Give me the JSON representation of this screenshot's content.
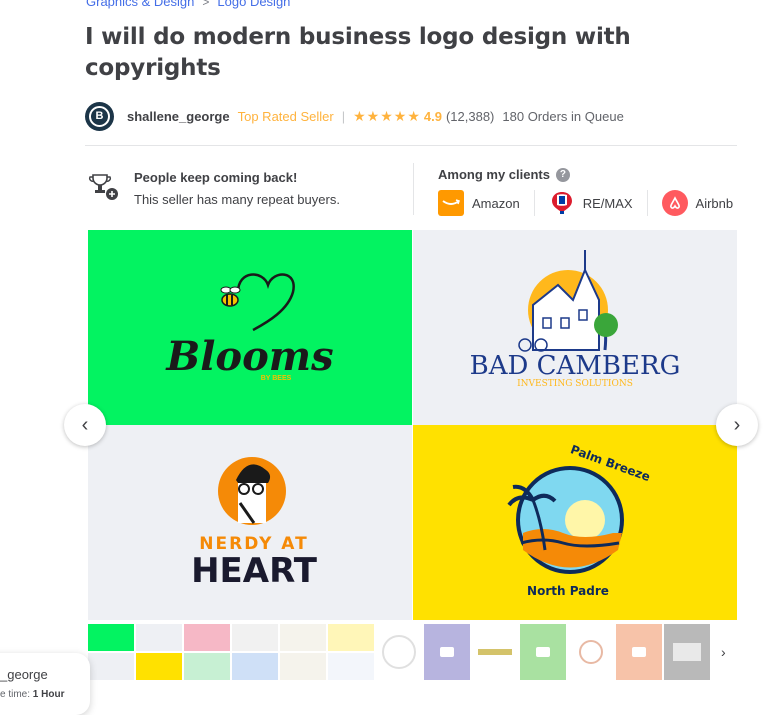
{
  "breadcrumb": {
    "items": [
      "Graphics & Design",
      "Logo Design"
    ],
    "separator": ">"
  },
  "gig": {
    "title": "I will do modern business logo design with copyrights"
  },
  "seller": {
    "avatar_letter": "B",
    "username": "shallene_george",
    "level": "Top Rated Seller",
    "separator": "|",
    "stars": "★★★★★",
    "rating": "4.9",
    "review_count": "(12,388)",
    "orders_in_queue": "180 Orders in Queue"
  },
  "highlights": {
    "title": "People keep coming back!",
    "text": "This seller has many repeat buyers."
  },
  "clients": {
    "title": "Among my clients",
    "help_icon": "?",
    "list": [
      {
        "name": "Amazon",
        "icon": "amazon-logo",
        "color": "#ff9900"
      },
      {
        "name": "RE/MAX",
        "icon": "remax-logo",
        "color": "#dc1c2e"
      },
      {
        "name": "Airbnb",
        "icon": "airbnb-logo",
        "color": "#ff5a5f"
      }
    ]
  },
  "gallery": {
    "prev_icon": "‹",
    "next_icon": "›",
    "logos": [
      {
        "name": "Blooms",
        "tagline": "BY BEES",
        "bg": "#03f361"
      },
      {
        "name": "BAD CAMBERG",
        "tagline": "INVESTING SOLUTIONS",
        "bg": "#eef0f4"
      },
      {
        "name_line1": "NERDY AT",
        "name_line2": "HEART",
        "bg": "#eef0f4"
      },
      {
        "arc_top": "Palm Breeze",
        "arc_bottom": "North Padre",
        "bg": "#ffe100"
      }
    ]
  },
  "thumbnails": {
    "next_icon": "›"
  },
  "popup": {
    "username": "_george",
    "time_label": "e time:",
    "time_value": "1 Hour"
  },
  "colors": {
    "accent_link": "#446ee7",
    "star": "#ffb33e",
    "title": "#404145"
  }
}
